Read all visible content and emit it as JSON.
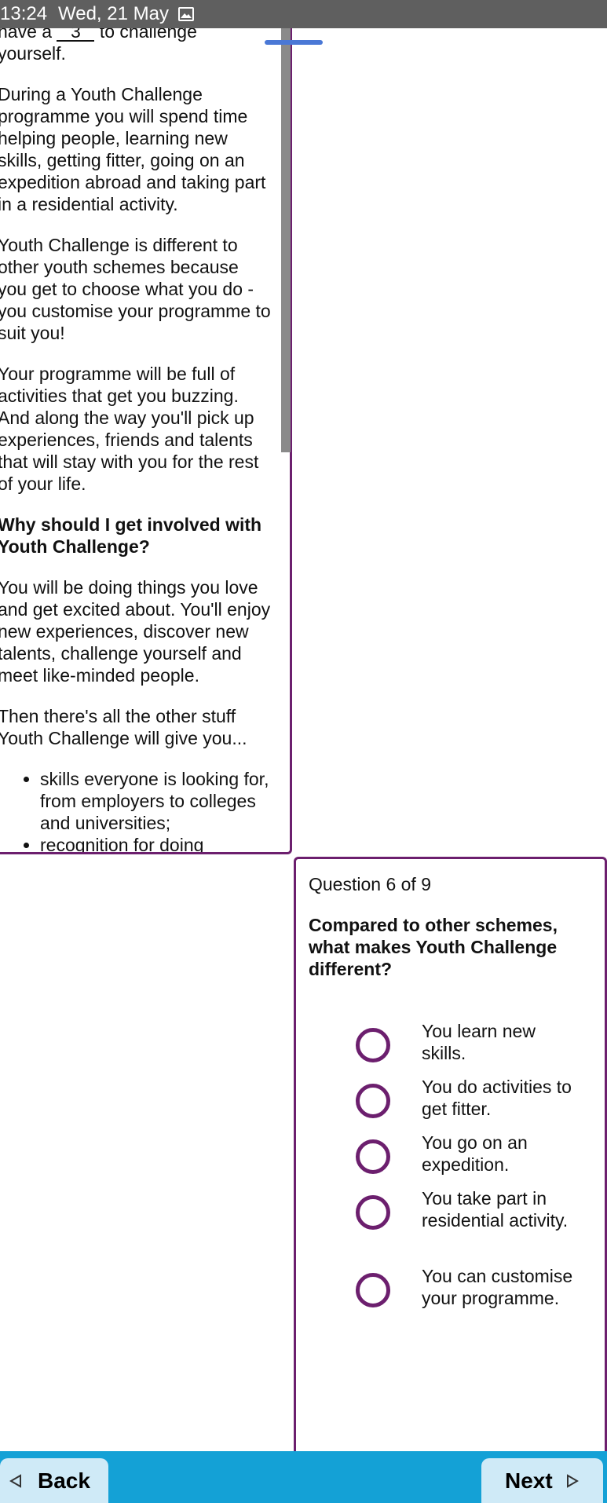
{
  "status_bar": {
    "time": "13:24",
    "date": "Wed, 21 May",
    "icon": "image-icon"
  },
  "passage": {
    "line1_before": "have a",
    "blank_value": "3",
    "line1_after": "to challenge",
    "line2": "yourself.",
    "p1": "During a Youth Challenge programme you will spend time helping people, learning new skills, getting fitter, going on an expedition abroad and taking part in a residential activity.",
    "p2": "Youth Challenge is different to other youth schemes because you get to choose what you do - you customise your programme to suit you!",
    "p3": "Your programme will be full of activities that get you buzzing. And along the way you'll pick up experiences, friends and talents that will stay with you for the rest of your life.",
    "heading": "Why should I get involved with Youth Challenge?",
    "p4": "You will be doing things you love and get excited about. You'll enjoy new experiences, discover new talents, challenge yourself and meet like-minded people.",
    "p5": "Then there's all the other stuff Youth Challenge will give you...",
    "bullets": [
      "skills everyone is looking for, from employers to colleges and universities;",
      "recognition for doing"
    ]
  },
  "question": {
    "counter": "Question 6 of 9",
    "text": "Compared to other schemes, what makes Youth Challenge different?",
    "options": [
      "You learn new skills.",
      "You do activities to get fitter.",
      "You go on an expedition.",
      "You take part in residential activity.",
      "You can customise your programme."
    ]
  },
  "nav": {
    "back_label": "Back",
    "next_label": "Next"
  },
  "colors": {
    "accent": "#6c1f6e",
    "bar": "#14a1d6",
    "button": "#cfeaf7",
    "status_bar": "#5f5f5f"
  }
}
